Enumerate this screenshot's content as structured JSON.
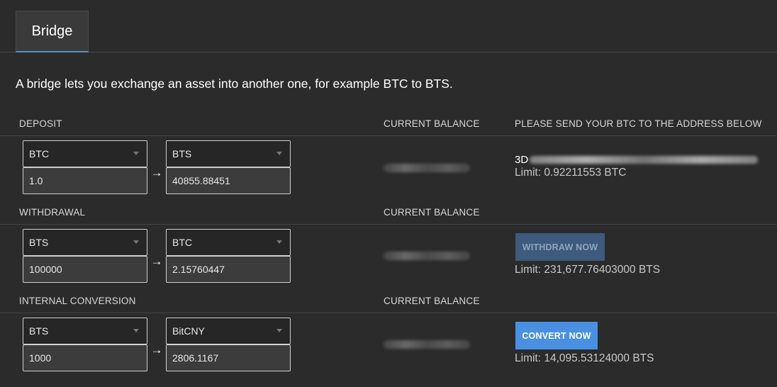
{
  "tabs": [
    {
      "label": "Bridge",
      "active": true
    }
  ],
  "intro_text": "A bridge lets you exchange an asset into another one, for example BTC to BTS.",
  "columns": {
    "current_balance": "CURRENT BALANCE"
  },
  "deposit": {
    "title": "DEPOSIT",
    "instruction": "PLEASE SEND YOUR BTC TO THE ADDRESS BELOW",
    "from_asset": "BTC",
    "to_asset": "BTS",
    "from_amount": "1.0",
    "to_amount": "40855.88451",
    "address_prefix": "3D",
    "limit": "Limit: 0.92211553 BTC"
  },
  "withdrawal": {
    "title": "WITHDRAWAL",
    "from_asset": "BTS",
    "to_asset": "BTC",
    "from_amount": "100000",
    "to_amount": "2.15760447",
    "button_label": "WITHDRAW NOW",
    "limit": "Limit: 231,677.76403000 BTS"
  },
  "internal_conversion": {
    "title": "INTERNAL CONVERSION",
    "from_asset": "BTS",
    "to_asset": "BitCNY",
    "from_amount": "1000",
    "to_amount": "2806.1167",
    "button_label": "CONVERT NOW",
    "limit": "Limit: 14,095.53124000 BTS"
  },
  "arrow_glyph": "→",
  "icons": {
    "dropdown": "chevron-down-icon",
    "arrow": "arrow-right-icon"
  },
  "colors": {
    "background": "#2b2b2b",
    "tab_underline": "#5a8fc7",
    "button_primary": "#4a90e2",
    "button_disabled": "#3e5a7d"
  }
}
